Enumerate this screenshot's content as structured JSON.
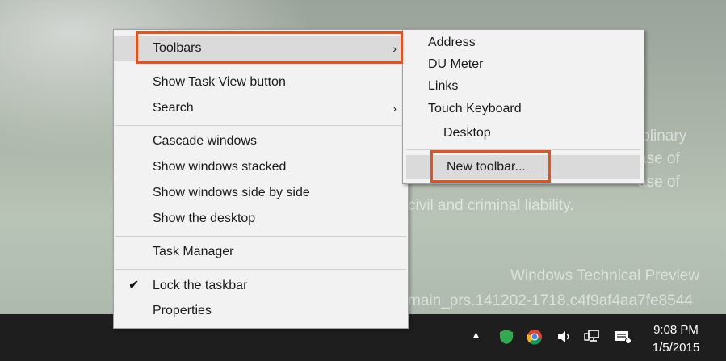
{
  "wallpaper": {
    "lines": [
      "iplinary",
      "ase of",
      "ase of",
      "civil and criminal liability.",
      "Windows Technical Preview",
      "main_prs.141202-1718.c4f9af4aa7fe8544"
    ]
  },
  "context_menu": {
    "items": [
      {
        "label": "Toolbars",
        "arrow": "›"
      },
      {
        "label": "Show Task View button"
      },
      {
        "label": "Search",
        "arrow": "›"
      },
      {
        "label": "Cascade windows"
      },
      {
        "label": "Show windows stacked"
      },
      {
        "label": "Show windows side by side"
      },
      {
        "label": "Show the desktop"
      },
      {
        "label": "Task Manager"
      },
      {
        "label": "Lock the taskbar",
        "check": "✔"
      },
      {
        "label": "Properties"
      }
    ]
  },
  "toolbars_submenu": {
    "items": [
      {
        "label": "Address"
      },
      {
        "label": "DU Meter"
      },
      {
        "label": "Links"
      },
      {
        "label": "Touch Keyboard"
      },
      {
        "label": "Desktop"
      },
      {
        "label": "New toolbar..."
      }
    ]
  },
  "taskbar": {
    "tray_icons": [
      "chevron-up-icon",
      "shield-icon",
      "chrome-icon",
      "volume-icon",
      "network-icon",
      "notification-icon"
    ],
    "clock": {
      "time": "9:08 PM",
      "date": "1/5/2015"
    }
  },
  "colors": {
    "highlight_border": "#e8501c",
    "menu_bg": "#f2f2f2",
    "taskbar_bg": "#1e1e1e"
  }
}
